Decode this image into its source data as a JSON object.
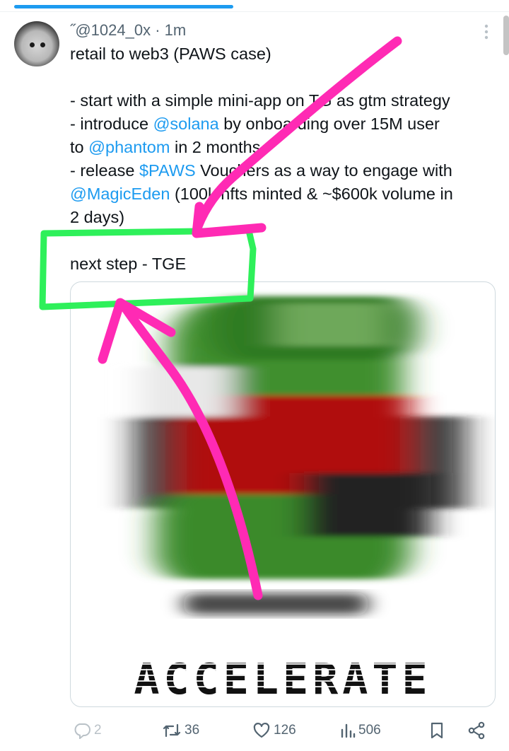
{
  "top_progress": 0.43,
  "tweet": {
    "author_handle": "@1024_0x",
    "author_prefix": "˝",
    "separator": "·",
    "time": "1m",
    "lines": [
      {
        "parts": [
          {
            "text": "retail to web3 (PAWS case)"
          }
        ]
      },
      {
        "gap": true
      },
      {
        "parts": [
          {
            "text": "- start with a simple mini-app on TG as gtm strategy"
          }
        ]
      },
      {
        "parts": [
          {
            "text": "- introduce "
          },
          {
            "text": "@solana",
            "mention": true
          },
          {
            "text": " by onboarding over 15M user"
          }
        ]
      },
      {
        "parts": [
          {
            "text": "to "
          },
          {
            "text": "@phantom",
            "mention": true
          },
          {
            "text": " in 2 months"
          }
        ]
      },
      {
        "parts": [
          {
            "text": "- release "
          },
          {
            "text": "$PAWS",
            "mention": true
          },
          {
            "text": " Vouchers as a way to engage with"
          }
        ]
      },
      {
        "parts": [
          {
            "text": "@MagicEden",
            "mention": true
          },
          {
            "text": " (100k nfts minted & ~$600k volume in"
          }
        ]
      },
      {
        "parts": [
          {
            "text": "2 days)"
          }
        ]
      },
      {
        "gap": true
      },
      {
        "parts": [
          {
            "text": "next step - TGE"
          }
        ]
      }
    ],
    "media": {
      "caption_text": "ACCELERATE",
      "description_colors": {
        "green": "#3f8f2f",
        "red": "#b01010",
        "dark": "#1a1a1a"
      }
    }
  },
  "actions": {
    "reply_count": "2",
    "retweet_count": "36",
    "like_count": "126",
    "views_count": "506"
  },
  "colors": {
    "accent": "#1d9bf0",
    "muted": "#536471",
    "annotation_pink": "#ff2ab4",
    "annotation_green": "#2ef05a"
  },
  "icons": [
    "more-vertical-icon",
    "reply-icon",
    "retweet-icon",
    "like-icon",
    "views-icon",
    "bookmark-icon",
    "share-icon"
  ]
}
